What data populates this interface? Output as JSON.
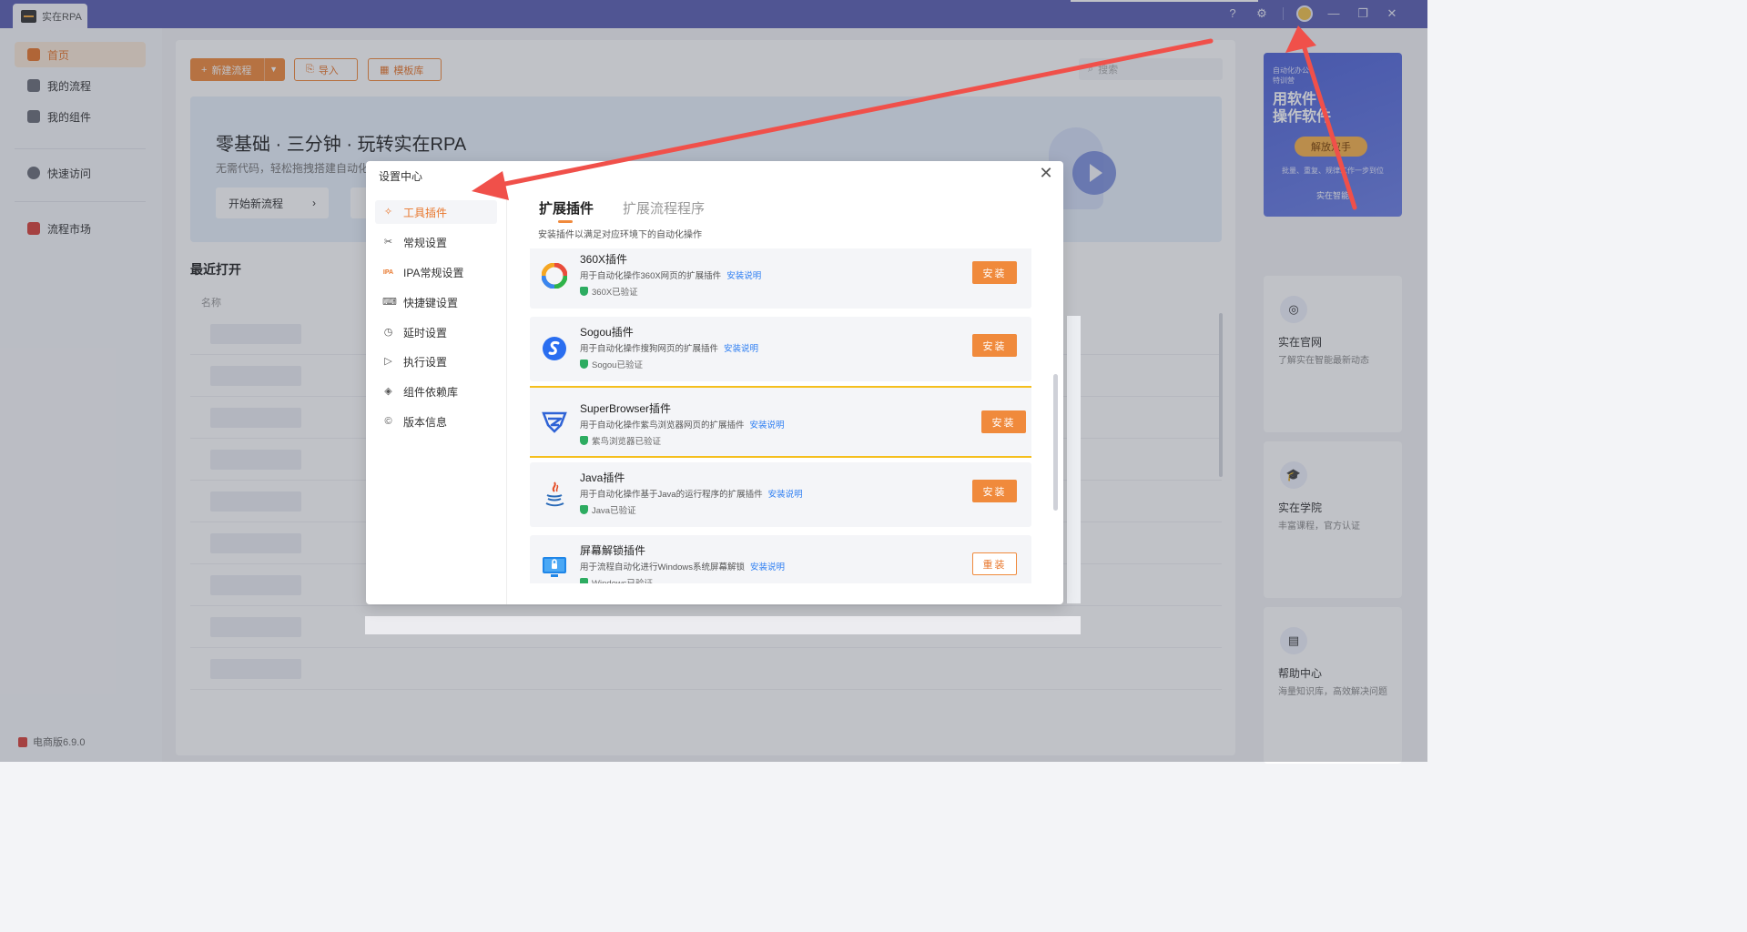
{
  "titlebar": {
    "app_name": "实在RPA",
    "icons": [
      "help-icon",
      "gear-icon",
      "avatar",
      "minimize-icon",
      "restore-icon",
      "close-icon"
    ]
  },
  "sidebar": {
    "items": [
      {
        "label": "首页",
        "icon": "home-icon",
        "active": true
      },
      {
        "label": "我的流程",
        "icon": "flow-icon"
      },
      {
        "label": "我的组件",
        "icon": "layers-icon"
      },
      {
        "label": "快速访问",
        "icon": "clock-icon"
      },
      {
        "label": "流程市场",
        "icon": "store-icon"
      }
    ],
    "version": "电商版6.9.0"
  },
  "main": {
    "toolbar": {
      "new_label": "新建流程",
      "import_label": "导入",
      "template_label": "模板库",
      "search_placeholder": "搜索"
    },
    "banner": {
      "title": "零基础 · 三分钟 · 玩转实在RPA",
      "subtitle": "无需代码，轻松拖拽搭建自动化",
      "button_label": "开始新流程"
    },
    "recent_title": "最近打开",
    "table_header": "名称"
  },
  "right_panel": {
    "promo": {
      "small_text": "自动化办公\n特训营",
      "big_text": "用软件\n操作软件",
      "button": "解放双手",
      "footer": "批量、重复、规律工作一步到位",
      "brand": "实在智能"
    },
    "cards": [
      {
        "title": "实在官网",
        "subtitle": "了解实在智能最新动态",
        "icon": "globe-icon"
      },
      {
        "title": "实在学院",
        "subtitle": "丰富课程，官方认证",
        "icon": "graduation-icon"
      },
      {
        "title": "帮助中心",
        "subtitle": "海量知识库，高效解决问题",
        "icon": "book-icon"
      }
    ]
  },
  "modal": {
    "title": "设置中心",
    "nav": [
      {
        "label": "工具插件",
        "icon": "puzzle-icon",
        "active": true
      },
      {
        "label": "常规设置",
        "icon": "tools-icon"
      },
      {
        "label": "IPA常规设置",
        "icon": "ipa-icon"
      },
      {
        "label": "快捷键设置",
        "icon": "keyboard-icon"
      },
      {
        "label": "延时设置",
        "icon": "clock-icon"
      },
      {
        "label": "执行设置",
        "icon": "play-icon"
      },
      {
        "label": "组件依赖库",
        "icon": "layers-icon"
      },
      {
        "label": "版本信息",
        "icon": "copyright-icon"
      }
    ],
    "tabs": [
      {
        "label": "扩展插件",
        "active": true
      },
      {
        "label": "扩展流程程序"
      }
    ],
    "tab_description": "安装插件以满足对应环境下的自动化操作",
    "plugins": [
      {
        "name": "360X插件",
        "desc": "用于自动化操作360X网页的扩展插件",
        "link": "安装说明",
        "verified": "360X已验证",
        "button": "安装",
        "icon": "360x-icon"
      },
      {
        "name": "Sogou插件",
        "desc": "用于自动化操作搜狗网页的扩展插件",
        "link": "安装说明",
        "verified": "Sogou已验证",
        "button": "安装",
        "icon": "sogou-icon"
      },
      {
        "name": "SuperBrowser插件",
        "desc": "用于自动化操作紫鸟浏览器网页的扩展插件",
        "link": "安装说明",
        "verified": "紫鸟浏览器已验证",
        "button": "安装",
        "icon": "superbrowser-icon",
        "highlighted": true
      },
      {
        "name": "Java插件",
        "desc": "用于自动化操作基于Java的运行程序的扩展插件",
        "link": "安装说明",
        "verified": "Java已验证",
        "button": "安装",
        "icon": "java-icon"
      },
      {
        "name": "屏幕解锁插件",
        "desc": "用于流程自动化进行Windows系统屏幕解锁",
        "link": "安装说明",
        "verified": "Windows已验证",
        "button": "重装",
        "icon": "screen-lock-icon"
      }
    ]
  },
  "colors": {
    "titlebar": "#5a5fb3",
    "accent": "#f08a3c",
    "link": "#2d7ef2",
    "highlight_border": "#f5bf1d",
    "arrow": "#f0504a"
  }
}
